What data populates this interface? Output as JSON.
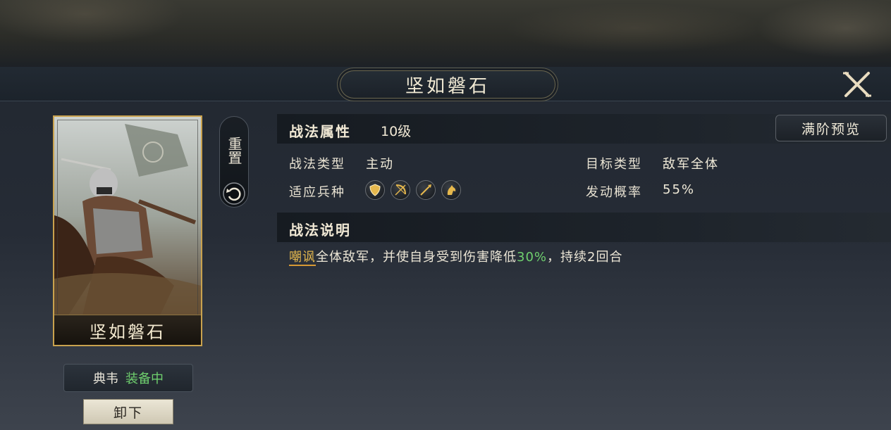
{
  "title": "坚如磐石",
  "card": {
    "name": "坚如磐石"
  },
  "reset": {
    "label": "重置"
  },
  "equip": {
    "general": "典韦",
    "status": "装备中"
  },
  "unequip_label": "卸下",
  "attributes": {
    "header": "战法属性",
    "level": "10级",
    "full_preview": "满阶预览",
    "type_label": "战法类型",
    "type_value": "主动",
    "target_label": "目标类型",
    "target_value": "敌军全体",
    "troops_label": "适应兵种",
    "troops": [
      "shield-icon",
      "bow-icon",
      "spear-icon",
      "horse-icon"
    ],
    "rate_label": "发动概率",
    "rate_value": "55%"
  },
  "description": {
    "header": "战法说明",
    "keyword": "嘲讽",
    "text_part1": "全体敌军，并使自身受到伤害降低",
    "percent": "30%",
    "text_part2": "，持续2回合"
  },
  "colors": {
    "accent_gold": "#c9a24e",
    "equipped_green": "#6fcf6e",
    "keyword_orange": "#e2b64d"
  }
}
